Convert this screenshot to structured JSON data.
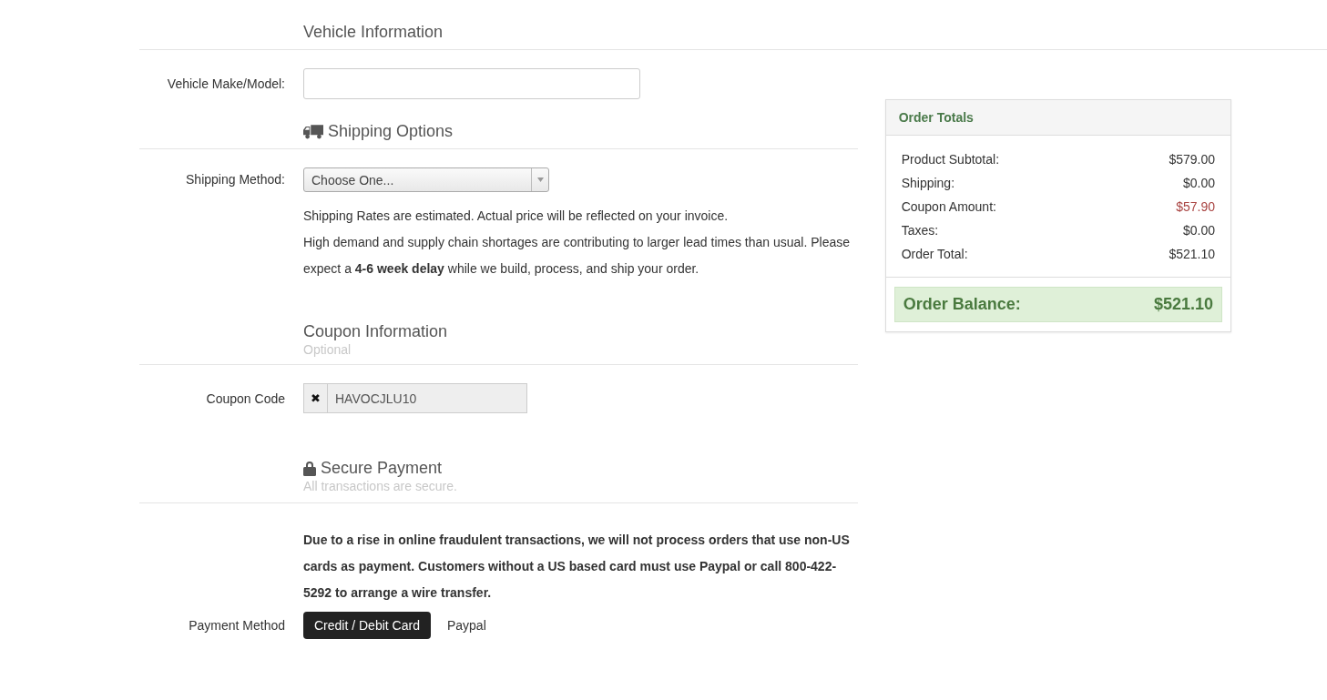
{
  "vehicle": {
    "title": "Vehicle Information",
    "fields": [
      {
        "label": "Vehicle Make/Model:"
      }
    ]
  },
  "shipping": {
    "title": "Shipping Options",
    "method_label": "Shipping Method:",
    "select_value": "Choose One...",
    "notes": [
      "Shipping Rates are estimated. Actual price will be reflected on your invoice.",
      "High demand and supply chain shortages are contributing to larger lead times than usual. Please expect a **4-6 week delay** while we build, process, and ship your order."
    ]
  },
  "coupon": {
    "title": "Coupon Information",
    "subtitle": "Optional",
    "label": "Coupon Code",
    "remove": "✖",
    "value": "HAVOCJLU10"
  },
  "payment": {
    "title": "Secure Payment",
    "subtitle": "All transactions are secure.",
    "notice": "Due to a rise in online fraudulent transactions, we will not process orders that use non-US cards as payment. Customers without a US based card must use Paypal or call 800-422-5292 to arrange a wire transfer.",
    "method_label": "Payment Method",
    "methods": [
      {
        "label": "Credit / Debit Card",
        "selected": true
      },
      {
        "label": "Paypal",
        "selected": false
      }
    ]
  },
  "order_totals": {
    "title": "Order Totals",
    "rows": [
      {
        "label": "Product Subtotal:",
        "value": "$579.00",
        "kind": "normal"
      },
      {
        "label": "Shipping:",
        "value": "$0.00",
        "kind": "normal"
      },
      {
        "label": "Coupon Amount:",
        "value": "$57.90",
        "kind": "discount"
      },
      {
        "label": "Taxes:",
        "value": "$0.00",
        "kind": "normal"
      },
      {
        "label": "Order Total:",
        "value": "$521.10",
        "kind": "normal"
      }
    ],
    "balance_label": "Order Balance:",
    "balance_value": "$521.10"
  }
}
